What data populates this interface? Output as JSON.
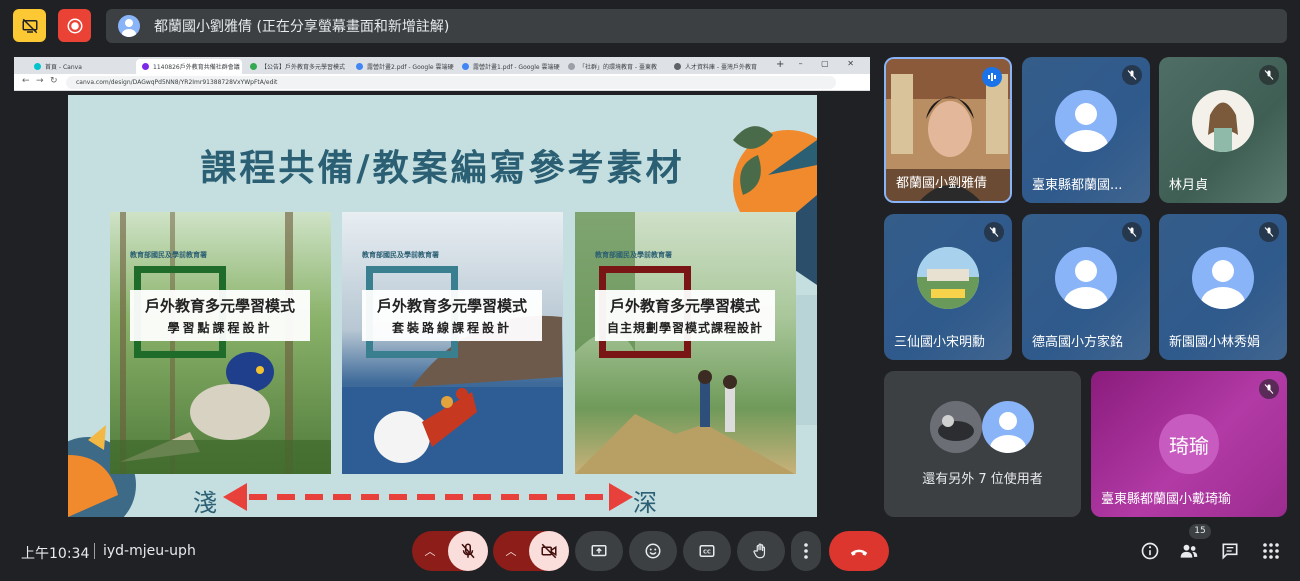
{
  "banner": {
    "presenting_text": "都蘭國小劉雅倩 (正在分享螢幕畫面和新增註解)"
  },
  "browser": {
    "tabs": [
      {
        "label": "首頁 - Canva",
        "color": "#00c4cc"
      },
      {
        "label": "1140826戶外教育共備社群會議",
        "color": "#7d2ae8"
      },
      {
        "label": "【公告】戶外教育多元學習模式",
        "color": "#34a853"
      },
      {
        "label": "露營計畫2.pdf - Google 雲端硬碟",
        "color": "#4285f4"
      },
      {
        "label": "露營計畫1.pdf - Google 雲端硬碟",
        "color": "#4285f4"
      },
      {
        "label": "「社群」的環境教育 - 臺東教",
        "color": "#9aa0a6"
      },
      {
        "label": "人才資料庫 - 臺灣戶外教育",
        "color": "#5f6368"
      }
    ],
    "url": "canva.com/design/DAGwqPd5NN8/YR2Imr91388728VxYWpFtA/edit"
  },
  "slide": {
    "title": "課程共備/教案編寫參考素材",
    "books": [
      {
        "ministry": "教育部國民及學前教育署",
        "title": "戶外教育多元學習模式",
        "subtitle": "學習點課程設計",
        "frame_color": "#1e6b2a"
      },
      {
        "ministry": "教育部國民及學前教育署",
        "title": "戶外教育多元學習模式",
        "subtitle": "套裝路線課程設計",
        "frame_color": "#3a7f90"
      },
      {
        "ministry": "教育部國民及學前教育署",
        "title": "戶外教育多元學習模式",
        "subtitle": "自主規劃學習模式課程設計",
        "frame_color": "#7a1515"
      }
    ],
    "depth_left": "淺",
    "depth_right": "深"
  },
  "participants": [
    {
      "name": "都蘭國小劉雅倩",
      "speaking": true
    },
    {
      "name": "臺東縣都蘭國...",
      "muted": true
    },
    {
      "name": "林月貞",
      "muted": true
    },
    {
      "name": "三仙國小宋明勳",
      "muted": true
    },
    {
      "name": "德高國小方家銘",
      "muted": true
    },
    {
      "name": "新園國小林秀娟",
      "muted": true
    },
    {
      "name": "臺東縣都蘭國小戴琦瑜",
      "muted": true,
      "initials": "琦瑜"
    }
  ],
  "others": {
    "text": "還有另外 7 位使用者"
  },
  "footer": {
    "time": "上午10:34",
    "meeting_code": "iyd-mjeu-uph",
    "participant_count": "15"
  },
  "colors": {
    "end_call": "#dc362e",
    "accent": "#8ab4f8",
    "mic_off_bg": "#f9dedc"
  }
}
